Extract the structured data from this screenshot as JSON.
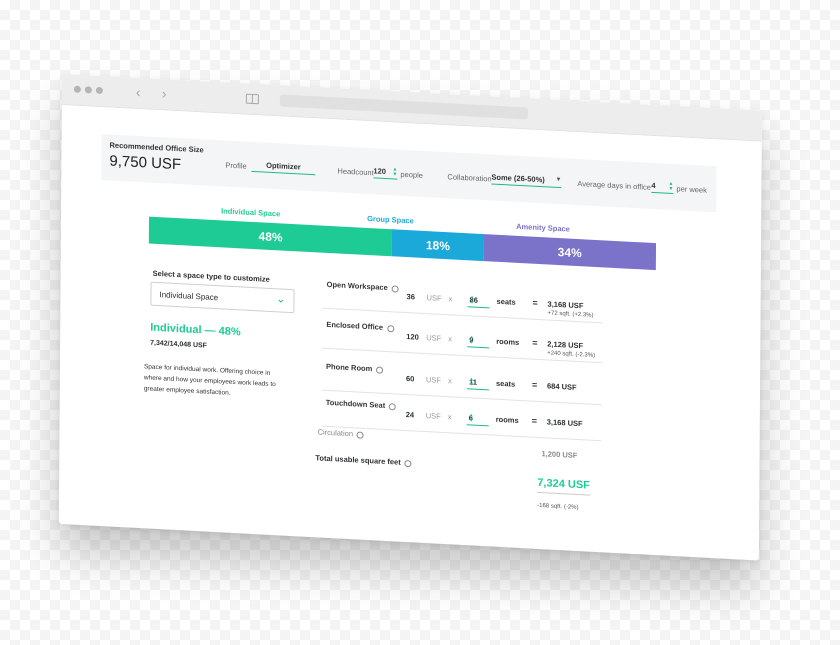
{
  "header": {
    "rec_label": "Recommended Office Size",
    "rec_value": "9,750 USF",
    "tab_profile": "Profile",
    "tab_optimizer": "Optimizer",
    "headcount_label": "Headcount",
    "headcount_value": "120",
    "headcount_unit": "people",
    "collab_label": "Collaboration",
    "collab_value": "Some (26-50%)",
    "days_label": "Average days in office",
    "days_value": "4",
    "days_unit": "per week"
  },
  "breakdown": {
    "individual_label": "Individual Space",
    "individual_pct": "48%",
    "group_label": "Group Space",
    "group_pct": "18%",
    "amenity_label": "Amenity Space",
    "amenity_pct": "34%",
    "values": {
      "individual": 48,
      "group": 18,
      "amenity": 34
    },
    "colors": {
      "individual": "#1fcb94",
      "group": "#1aa9d9",
      "amenity": "#7b72c9"
    }
  },
  "left": {
    "select_label": "Select a space type to customize",
    "select_value": "Individual Space",
    "summary_title": "Individual — 48%",
    "summary_sub": "7,342/14,048 USF",
    "description": "Space for individual work. Offering choice in where and how your employees work leads to greater employee satisfaction."
  },
  "rows": [
    {
      "name": "Open Workspace",
      "usf_each": "36",
      "usf": "USF",
      "x": "x",
      "count": "86",
      "unit": "seats",
      "eq": "=",
      "total": "3,168 USF",
      "delta": "+72 sqft. (+2.3%)"
    },
    {
      "name": "Enclosed Office",
      "usf_each": "120",
      "usf": "USF",
      "x": "x",
      "count": "9",
      "unit": "rooms",
      "eq": "=",
      "total": "2,128 USF",
      "delta": "+240 sqft. (-2.3%)"
    },
    {
      "name": "Phone Room",
      "usf_each": "60",
      "usf": "USF",
      "x": "x",
      "count": "11",
      "unit": "seats",
      "eq": "=",
      "total": "684 USF",
      "delta": ""
    },
    {
      "name": "Touchdown Seat",
      "usf_each": "24",
      "usf": "USF",
      "x": "x",
      "count": "6",
      "unit": "rooms",
      "eq": "=",
      "total": "3,168 USF",
      "delta": ""
    }
  ],
  "circulation": {
    "label": "Circulation",
    "value": "1,200 USF"
  },
  "total": {
    "label": "Total usable square feet",
    "value": "7,324 USF",
    "delta": "-168 sqft. (-2%)"
  }
}
